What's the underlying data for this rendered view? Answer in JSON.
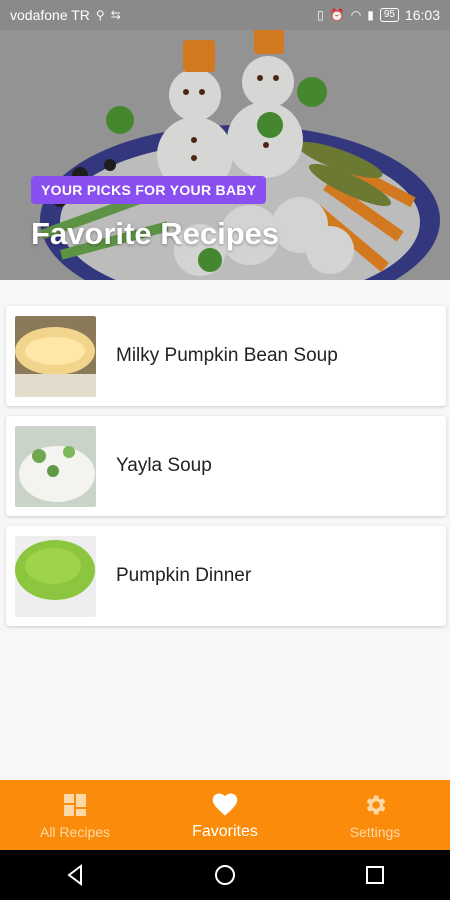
{
  "status_bar": {
    "carrier": "vodafone TR",
    "battery": "95",
    "time": "16:03"
  },
  "hero": {
    "badge": "YOUR PICKS FOR YOUR BABY",
    "title": "Favorite Recipes"
  },
  "recipes": [
    {
      "title": "Milky Pumpkin Bean Soup"
    },
    {
      "title": "Yayla Soup"
    },
    {
      "title": "Pumpkin Dinner"
    }
  ],
  "bottom_nav": {
    "items": [
      {
        "label": "All Recipes",
        "icon": "grid-icon"
      },
      {
        "label": "Favorites",
        "icon": "heart-icon"
      },
      {
        "label": "Settings",
        "icon": "gear-icon"
      }
    ],
    "active": "Favorites"
  },
  "colors": {
    "accent": "#fb8b0a",
    "badge": "#8a4ff0"
  }
}
